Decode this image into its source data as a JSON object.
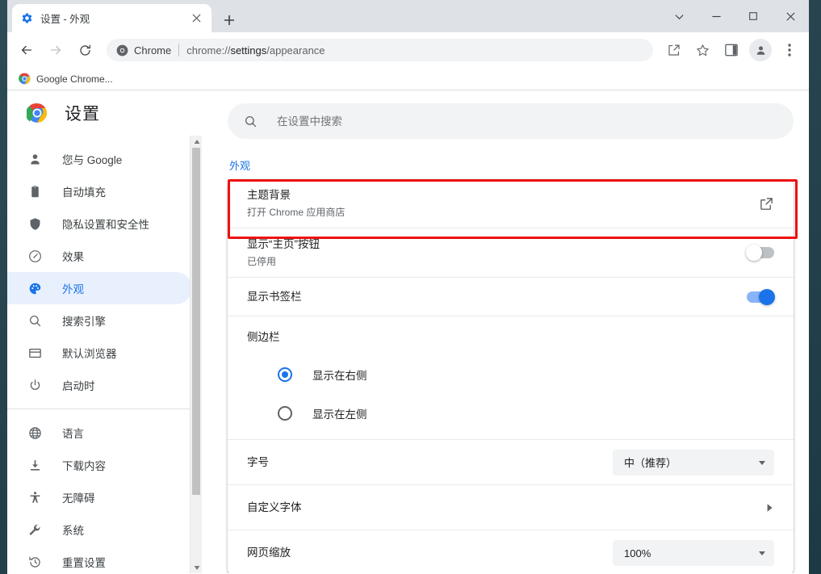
{
  "window": {
    "controls": {
      "search_tabs": "chevron-down-icon",
      "minimize": "minimize-icon",
      "maximize": "maximize-icon",
      "close": "close-icon"
    }
  },
  "tabs": [
    {
      "title": "设置 - 外观",
      "favicon": "settings-gear-icon",
      "active": true
    }
  ],
  "new_tab_label": "+",
  "toolbar": {
    "back": "back-arrow-icon",
    "forward": "forward-arrow-icon",
    "reload": "reload-icon",
    "omnibox": {
      "chip_label": "Chrome",
      "url_prefix": "chrome://",
      "url_bold": "settings",
      "url_suffix": "/appearance",
      "full_url": "chrome://settings/appearance"
    },
    "share": "share-icon",
    "bookmark": "star-icon",
    "side_panel": "side-panel-icon",
    "profile": "profile-avatar-icon",
    "menu": "three-dots-menu-icon"
  },
  "bookmarks_bar": {
    "items": [
      {
        "label": "Google Chrome...",
        "icon": "chrome-logo-icon"
      }
    ]
  },
  "settings": {
    "brand": "设置",
    "nav_groups": [
      {
        "items": [
          {
            "label": "您与 Google",
            "icon": "person-icon",
            "selected": false
          },
          {
            "label": "自动填充",
            "icon": "clipboard-icon",
            "selected": false
          },
          {
            "label": "隐私设置和安全性",
            "icon": "shield-icon",
            "selected": false
          },
          {
            "label": "效果",
            "icon": "speedometer-icon",
            "selected": false
          },
          {
            "label": "外观",
            "icon": "palette-icon",
            "selected": true
          },
          {
            "label": "搜索引擎",
            "icon": "search-icon",
            "selected": false
          },
          {
            "label": "默认浏览器",
            "icon": "browser-window-icon",
            "selected": false
          },
          {
            "label": "启动时",
            "icon": "power-icon",
            "selected": false
          }
        ]
      },
      {
        "items": [
          {
            "label": "语言",
            "icon": "globe-icon",
            "selected": false
          },
          {
            "label": "下载内容",
            "icon": "download-icon",
            "selected": false
          },
          {
            "label": "无障碍",
            "icon": "accessibility-icon",
            "selected": false
          },
          {
            "label": "系统",
            "icon": "wrench-icon",
            "selected": false
          },
          {
            "label": "重置设置",
            "icon": "history-restore-icon",
            "selected": false
          }
        ]
      }
    ],
    "search": {
      "placeholder": "在设置中搜索",
      "value": "",
      "icon": "search-icon"
    },
    "section_title": "外观",
    "rows": {
      "theme": {
        "title": "主题背景",
        "subtitle": "打开 Chrome 应用商店",
        "action_icon": "open-in-new-icon",
        "highlighted": true
      },
      "home_button": {
        "title": "显示“主页”按钮",
        "subtitle": "已停用",
        "toggle_on": false
      },
      "bookmarks_bar": {
        "title": "显示书签栏",
        "toggle_on": true
      },
      "side_panel": {
        "title": "侧边栏",
        "options": [
          {
            "label": "显示在右侧",
            "checked": true
          },
          {
            "label": "显示在左侧",
            "checked": false
          }
        ]
      },
      "font_size": {
        "title": "字号",
        "value": "中（推荐）",
        "caret": "caret-down-icon"
      },
      "custom_fonts": {
        "title": "自定义字体",
        "action_icon": "chevron-right-icon"
      },
      "page_zoom": {
        "title": "网页缩放",
        "value": "100%",
        "caret": "caret-down-icon"
      }
    }
  },
  "colors": {
    "accent_blue": "#1a73e8",
    "selected_nav_bg": "#e8f0fe",
    "toggle_on_track": "#8ab4f8",
    "toggle_off_track": "#bdc1c6",
    "highlight_red": "#ee1111",
    "tabstrip_bg": "#dee1e6",
    "field_bg": "#f1f3f4",
    "desktop_bg": "#2b4750"
  }
}
